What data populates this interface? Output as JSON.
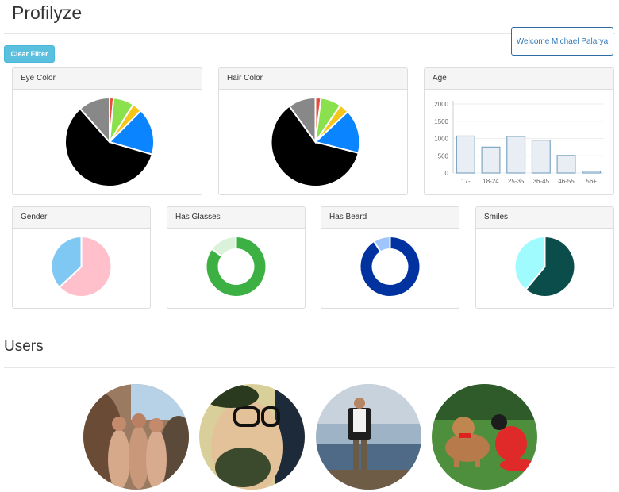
{
  "app": {
    "title": "Profilyze",
    "welcome": "Welcome Michael Palarya",
    "clear_filter": "Clear Filter"
  },
  "panels": {
    "eye_color": "Eye Color",
    "hair_color": "Hair Color",
    "age": "Age",
    "gender": "Gender",
    "has_glasses": "Has Glasses",
    "has_beard": "Has Beard",
    "smiles": "Smiles"
  },
  "users": {
    "title": "Users"
  },
  "chart_data": [
    {
      "type": "pie",
      "name": "Eye Color",
      "series": [
        {
          "value": 1.5,
          "color": "#e74c3c"
        },
        {
          "value": 7.5,
          "color": "#8be04e"
        },
        {
          "value": 3.5,
          "color": "#f5c518"
        },
        {
          "value": 17,
          "color": "#0a84ff"
        },
        {
          "value": 59,
          "color": "#000000"
        },
        {
          "value": 11.5,
          "color": "#888888"
        }
      ]
    },
    {
      "type": "pie",
      "name": "Hair Color",
      "series": [
        {
          "value": 2,
          "color": "#e74c3c"
        },
        {
          "value": 7.5,
          "color": "#8be04e"
        },
        {
          "value": 3.5,
          "color": "#f5c518"
        },
        {
          "value": 16,
          "color": "#0a84ff"
        },
        {
          "value": 61,
          "color": "#000000"
        },
        {
          "value": 10,
          "color": "#888888"
        }
      ]
    },
    {
      "type": "bar",
      "name": "Age",
      "categories": [
        "17-",
        "18-24",
        "25-35",
        "36-45",
        "46-55",
        "56+"
      ],
      "values": [
        1070,
        750,
        1060,
        950,
        510,
        50
      ],
      "ylim": [
        0,
        2000
      ],
      "yticks": [
        0,
        500,
        1000,
        1500,
        2000
      ],
      "bar_color": "#e8eef4",
      "bar_stroke": "#7fa7c4"
    },
    {
      "type": "pie",
      "name": "Gender",
      "series": [
        {
          "value": 63,
          "color": "#ffc0cb"
        },
        {
          "value": 37,
          "color": "#7ec8f3"
        }
      ]
    },
    {
      "type": "pie",
      "donut": true,
      "name": "Has Glasses",
      "series": [
        {
          "value": 85,
          "color": "#3cb043"
        },
        {
          "value": 15,
          "color": "#d9f2d9"
        }
      ]
    },
    {
      "type": "pie",
      "donut": true,
      "name": "Has Beard",
      "series": [
        {
          "value": 91,
          "color": "#0033a0"
        },
        {
          "value": 9,
          "color": "#9ec5fe"
        }
      ]
    },
    {
      "type": "pie",
      "name": "Smiles",
      "series": [
        {
          "value": 61,
          "color": "#0b4d4a"
        },
        {
          "value": 39,
          "color": "#a0fbff"
        }
      ]
    }
  ]
}
